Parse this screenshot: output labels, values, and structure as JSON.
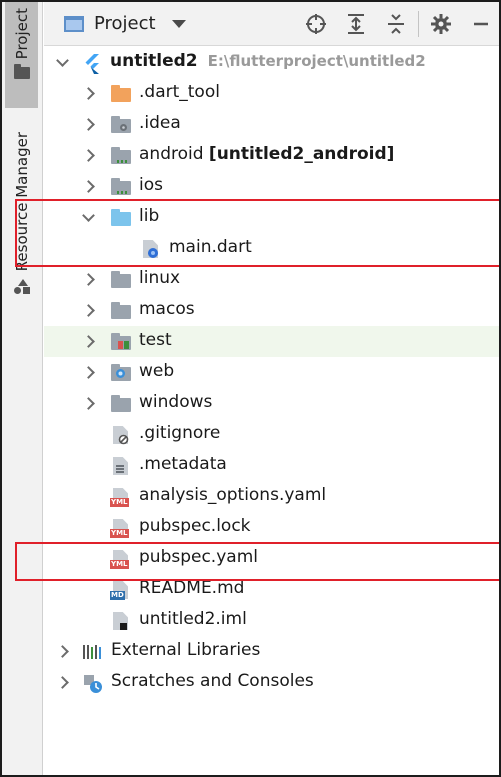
{
  "side_tabs": {
    "project": "Project",
    "resource_manager": "Resource Manager"
  },
  "toolbar": {
    "view_label": "Project"
  },
  "tree": {
    "root": {
      "name": "untitled2",
      "path": "E:\\flutterproject\\untitled2"
    },
    "items": [
      {
        "label": ".dart_tool"
      },
      {
        "label": ".idea"
      },
      {
        "label": "android",
        "suffix": "[untitled2_android]"
      },
      {
        "label": "ios"
      },
      {
        "label": "lib"
      },
      {
        "label": "main.dart"
      },
      {
        "label": "linux"
      },
      {
        "label": "macos"
      },
      {
        "label": "test"
      },
      {
        "label": "web"
      },
      {
        "label": "windows"
      },
      {
        "label": ".gitignore"
      },
      {
        "label": ".metadata"
      },
      {
        "label": "analysis_options.yaml",
        "badge": "YML"
      },
      {
        "label": "pubspec.lock",
        "badge": "YML"
      },
      {
        "label": "pubspec.yaml",
        "badge": "YML"
      },
      {
        "label": "README.md",
        "badge": "MD"
      },
      {
        "label": "untitled2.iml"
      }
    ],
    "external_libraries": "External Libraries",
    "scratches": "Scratches and Consoles"
  },
  "colors": {
    "highlight_box": "#e0202a",
    "test_row_bg": "#f0f7ec",
    "flutter_blue": "#42a5f5"
  }
}
